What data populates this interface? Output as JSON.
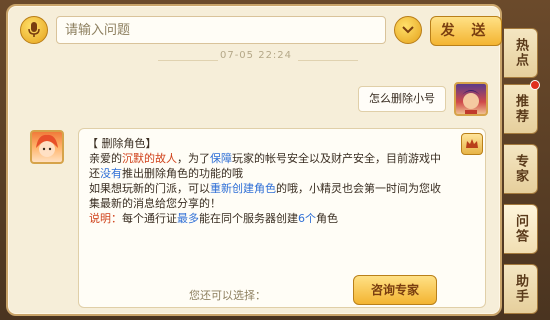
{
  "input": {
    "placeholder": "请输入问题",
    "send_label": "发 送"
  },
  "timestamp": "07-05 22:24",
  "user_message": {
    "text": "怎么删除小号"
  },
  "bot_message": {
    "title": "【 删除角色】",
    "line1_prefix": "亲爱的",
    "line1_red": "沉默的故人",
    "line1_mid": "，为了",
    "line1_blue": "保障",
    "line1_suffix": "玩家的帐号安全以及财产安全，目前游戏中",
    "line2_prefix": "还",
    "line2_red": "没有",
    "line2_suffix": "推出删除角色的功能的哦",
    "line3_prefix": "如果想玩新的门派，可以",
    "line3_blue": "重新创建角色",
    "line3_suffix": "的哦，小精灵也会第一时间为您收",
    "line4": "集最新的消息给您分享的！",
    "note_label": "说明：",
    "note_prefix": "每个通行证",
    "note_blue1": "最多",
    "note_mid": "能在同个服务器创建",
    "note_blue2": "6个",
    "note_suffix": "角色",
    "choose_label": "您还可以选择：",
    "expert_button": "咨询专家"
  },
  "tabs": [
    {
      "label": "热点",
      "active": false
    },
    {
      "label": "推荐",
      "active": false,
      "dot": true
    },
    {
      "label": "专家",
      "active": false
    },
    {
      "label": "问答",
      "active": true
    },
    {
      "label": "助手",
      "active": false
    }
  ],
  "colors": {
    "accent_red": "#d0421b",
    "accent_blue": "#2f6fd6",
    "button_gold": "#f3b431",
    "panel_bg": "#f6eed9"
  },
  "icons": {
    "mic": "microphone-icon",
    "dropdown": "chevron-down-icon",
    "badge": "crown-icon"
  }
}
